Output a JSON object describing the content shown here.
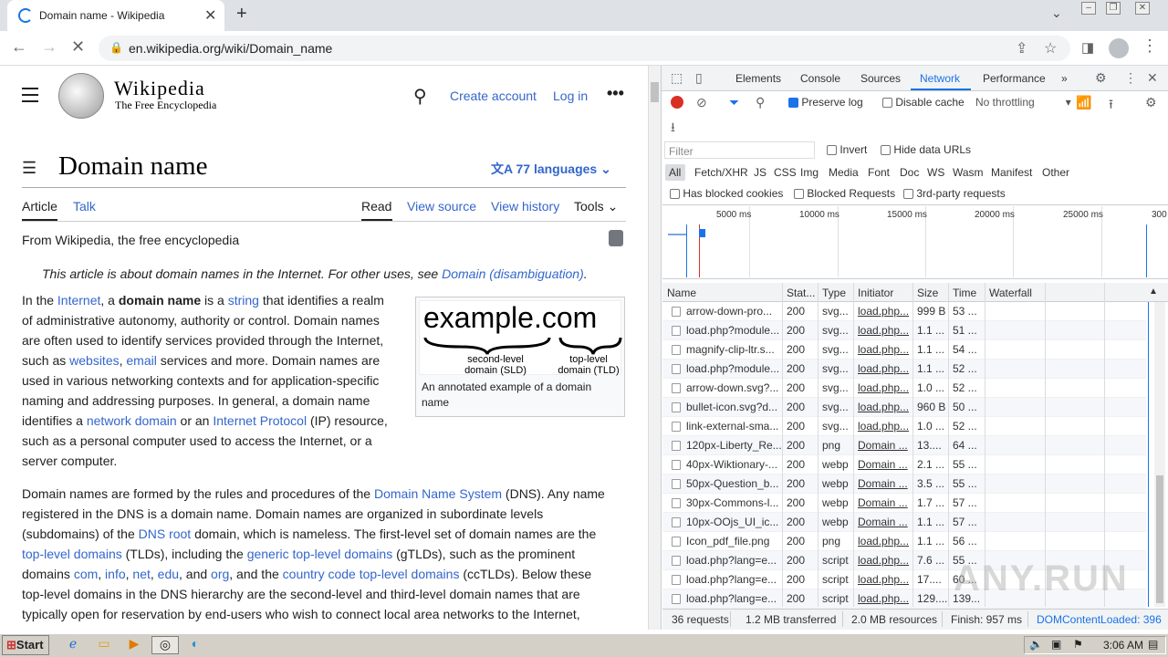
{
  "browser": {
    "tab_title": "Domain name - Wikipedia",
    "url": "en.wikipedia.org/wiki/Domain_name"
  },
  "wiki": {
    "wordmark": "Wikipedia",
    "tagline": "The Free Encyclopedia",
    "create_account": "Create account",
    "log_in": "Log in",
    "title": "Domain name",
    "languages": "77 languages",
    "tabs": {
      "article": "Article",
      "talk": "Talk",
      "read": "Read",
      "view_source": "View source",
      "view_history": "View history",
      "tools": "Tools"
    },
    "from": "From Wikipedia, the free encyclopedia",
    "hatnote_prefix": "This article is about domain names in the Internet. For other uses, see ",
    "hatnote_link": "Domain (disambiguation)",
    "infobox": {
      "big": "example.com",
      "sld": "second-level domain (SLD)",
      "tld": "top-level domain (TLD)",
      "caption": "An annotated example of a domain name"
    },
    "p1": [
      [
        "In the ",
        ""
      ],
      [
        "Internet",
        "l"
      ],
      [
        ", a ",
        ""
      ],
      [
        "domain name",
        "b"
      ],
      [
        " is a ",
        ""
      ],
      [
        "string",
        "l"
      ],
      [
        " that identifies a realm of administrative autonomy, authority or control. Domain names are often used to identify services provided through the Internet, such as ",
        ""
      ],
      [
        "websites",
        "l"
      ],
      [
        ", ",
        ""
      ],
      [
        "email",
        "l"
      ],
      [
        " services and more. Domain names are used in various networking contexts and for application-specific naming and addressing purposes. In general, a domain name identifies a ",
        ""
      ],
      [
        "network domain",
        "l"
      ],
      [
        " or an ",
        ""
      ],
      [
        "Internet Protocol",
        "l"
      ],
      [
        " (IP) resource, such as a personal computer used to access the Internet, or a server computer.",
        ""
      ]
    ],
    "p2": [
      [
        "Domain names are formed by the rules and procedures of the ",
        ""
      ],
      [
        "Domain Name System",
        "l"
      ],
      [
        " (DNS). Any name registered in the DNS is a domain name. Domain names are organized in subordinate levels (subdomains) of the ",
        ""
      ],
      [
        "DNS root",
        "l"
      ],
      [
        " domain, which is nameless. The first-level set of domain names are the ",
        ""
      ],
      [
        "top-level domains",
        "l"
      ],
      [
        " (TLDs), including the ",
        ""
      ],
      [
        "generic top-level domains",
        "l"
      ],
      [
        " (gTLDs), such as the prominent domains ",
        ""
      ],
      [
        "com",
        "l"
      ],
      [
        ", ",
        ""
      ],
      [
        "info",
        "l"
      ],
      [
        ", ",
        ""
      ],
      [
        "net",
        "l"
      ],
      [
        ", ",
        ""
      ],
      [
        "edu",
        "l"
      ],
      [
        ", and ",
        ""
      ],
      [
        "org",
        "l"
      ],
      [
        ", and the ",
        ""
      ],
      [
        "country code top-level domains",
        "l"
      ],
      [
        " (ccTLDs). Below these top-level domains in the DNS hierarchy are the second-level and third-level domain names that are typically open for reservation by end-users who wish to connect local area networks to the Internet, ",
        ""
      ]
    ]
  },
  "devtools": {
    "tabs": [
      "Elements",
      "Console",
      "Sources",
      "Network",
      "Performance"
    ],
    "preserve_log": "Preserve log",
    "disable_cache": "Disable cache",
    "throttling": "No throttling",
    "filter_placeholder": "Filter",
    "invert": "Invert",
    "hide_data_urls": "Hide data URLs",
    "types": [
      "All",
      "Fetch/XHR",
      "JS",
      "CSS",
      "Img",
      "Media",
      "Font",
      "Doc",
      "WS",
      "Wasm",
      "Manifest",
      "Other"
    ],
    "has_blocked_cookies": "Has blocked cookies",
    "blocked_requests": "Blocked Requests",
    "third_party": "3rd-party requests",
    "overview_ticks": [
      "5000 ms",
      "10000 ms",
      "15000 ms",
      "20000 ms",
      "25000 ms",
      "300"
    ],
    "columns": [
      "Name",
      "Stat...",
      "Type",
      "Initiator",
      "Size",
      "Time",
      "Waterfall"
    ],
    "rows": [
      [
        "arrow-down-pro...",
        "200",
        "svg...",
        "load.php...",
        "999 B",
        "53 ..."
      ],
      [
        "load.php?module...",
        "200",
        "svg...",
        "load.php...",
        "1.1 ...",
        "51 ..."
      ],
      [
        "magnify-clip-ltr.s...",
        "200",
        "svg...",
        "load.php...",
        "1.1 ...",
        "54 ..."
      ],
      [
        "load.php?module...",
        "200",
        "svg...",
        "load.php...",
        "1.1 ...",
        "52 ..."
      ],
      [
        "arrow-down.svg?...",
        "200",
        "svg...",
        "load.php...",
        "1.0 ...",
        "52 ..."
      ],
      [
        "bullet-icon.svg?d...",
        "200",
        "svg...",
        "load.php...",
        "960 B",
        "50 ..."
      ],
      [
        "link-external-sma...",
        "200",
        "svg...",
        "load.php...",
        "1.0 ...",
        "52 ..."
      ],
      [
        "120px-Liberty_Re...",
        "200",
        "png",
        "Domain ...",
        "13....",
        "64 ..."
      ],
      [
        "40px-Wiktionary-...",
        "200",
        "webp",
        "Domain ...",
        "2.1 ...",
        "55 ..."
      ],
      [
        "50px-Question_b...",
        "200",
        "webp",
        "Domain ...",
        "3.5 ...",
        "55 ..."
      ],
      [
        "30px-Commons-l...",
        "200",
        "webp",
        "Domain ...",
        "1.7 ...",
        "57 ..."
      ],
      [
        "10px-OOjs_UI_ic...",
        "200",
        "webp",
        "Domain ...",
        "1.1 ...",
        "57 ..."
      ],
      [
        "Icon_pdf_file.png",
        "200",
        "png",
        "load.php...",
        "1.1 ...",
        "56 ..."
      ],
      [
        "load.php?lang=e...",
        "200",
        "script",
        "load.php...",
        "7.6 ...",
        "55 ..."
      ],
      [
        "load.php?lang=e...",
        "200",
        "script",
        "load.php...",
        "17....",
        "60 ..."
      ],
      [
        "load.php?lang=e...",
        "200",
        "script",
        "load.php...",
        "129....",
        "139..."
      ]
    ],
    "status": {
      "requests": "36 requests",
      "transferred": "1.2 MB transferred",
      "resources": "2.0 MB resources",
      "finish": "Finish: 957 ms",
      "dcl": "DOMContentLoaded: 396"
    }
  },
  "watermark": "ANY.RUN",
  "taskbar": {
    "start": "Start",
    "clock": "3:06 AM"
  },
  "colors": {
    "link": "#3366cc",
    "accent": "#1a73e8",
    "record": "#d93025"
  }
}
